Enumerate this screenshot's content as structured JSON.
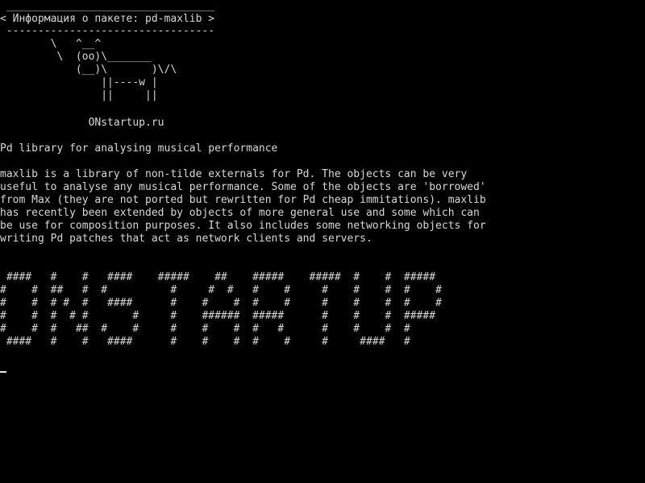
{
  "terminal": {
    "speech_bubble": {
      "top_border": " _________________________________",
      "text": "< Информация о пакете: pd-maxlib >",
      "bottom_border": " ---------------------------------"
    },
    "cow": [
      "        \\   ^__^",
      "         \\  (oo)\\_______",
      "            (__)\\       )\\/\\",
      "                ||----w |",
      "                ||     ||"
    ],
    "site": "              ONstartup.ru",
    "summary": "Pd library for analysing musical performance",
    "description": [
      "maxlib is a library of non-tilde externals for Pd. The objects can be very",
      "useful to analyse any musical performance. Some of the objects are 'borrowed'",
      "from Max (they are not ported but rewritten for Pd cheap immitations). maxlib",
      "has recently been extended by objects of more general use and some which can",
      "be use for composition purposes. It also includes some networking objects for",
      "writing Pd patches that act as network clients and servers."
    ],
    "banner": [
      " ####   #    #   ####    #####    ##    #####    #####  #    #  #####",
      "#    #  ##   #  #          #     #  #   #    #     #    #    #  #    #",
      "#    #  # #  #   ####      #    #    #  #    #     #    #    #  #    #",
      "#    #  #  # #       #     #    ######  #####      #    #    #  #####",
      "#    #  #   ##  #    #     #    #    #  #   #      #    #    #  #",
      " ####   #    #   ####      #    #    #  #    #     #     ####   #"
    ]
  }
}
